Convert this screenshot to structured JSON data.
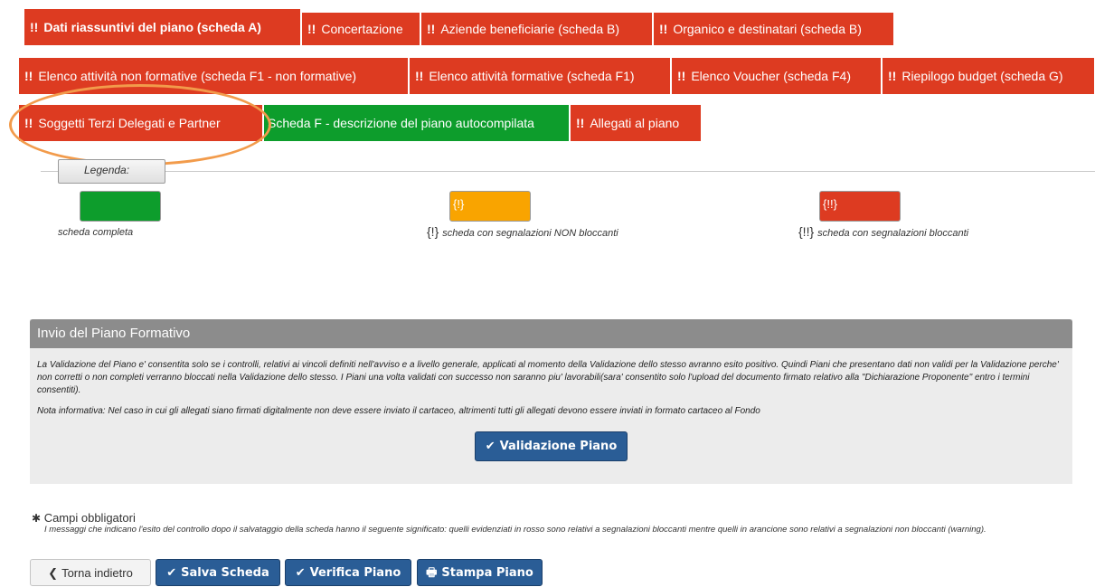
{
  "tabs": {
    "row1": [
      {
        "prefix": "!!",
        "label": "Dati riassuntivi del piano (scheda A)",
        "status": "red"
      },
      {
        "prefix": "!!",
        "label": "Concertazione",
        "status": "red"
      },
      {
        "prefix": "!!",
        "label": "Aziende beneficiarie (scheda B)",
        "status": "red"
      },
      {
        "prefix": "!!",
        "label": "Organico e destinatari (scheda B)",
        "status": "red"
      }
    ],
    "row2": [
      {
        "prefix": "!!",
        "label": "Elenco attività non formative (scheda F1 - non formative)",
        "status": "red"
      },
      {
        "prefix": "!!",
        "label": "Elenco attività formative (scheda F1)",
        "status": "red"
      },
      {
        "prefix": "!!",
        "label": "Elenco Voucher (scheda F4)",
        "status": "red"
      },
      {
        "prefix": "!!",
        "label": "Riepilogo budget (scheda G)",
        "status": "red"
      }
    ],
    "row3": [
      {
        "prefix": "!!",
        "label": "Soggetti Terzi Delegati e Partner",
        "status": "red"
      },
      {
        "prefix": "",
        "label": "Scheda F - descrizione del piano autocompilata",
        "status": "green"
      },
      {
        "prefix": "!!",
        "label": "Allegati al piano",
        "status": "red"
      }
    ]
  },
  "legend": {
    "title": "Legenda:",
    "items": [
      {
        "swatch_text": "",
        "mark": "",
        "text": "scheda completa",
        "color": "#0d9d2c"
      },
      {
        "swatch_text": "{!}",
        "mark": "{!}",
        "text": "scheda con segnalazioni NON bloccanti",
        "color": "#f9a400"
      },
      {
        "swatch_text": "{!!}",
        "mark": "{!!}",
        "text": "scheda con segnalazioni bloccanti",
        "color": "#dd3b21"
      }
    ]
  },
  "invio": {
    "title": "Invio del Piano Formativo",
    "paragraph1": "La Validazione del Piano e' consentita solo se i controlli, relativi ai vincoli definiti nell'avviso e a livello generale, applicati al momento della Validazione dello stesso avranno esito positivo. Quindi Piani che presentano dati non validi per la Validazione perche' non corretti o non completi verranno bloccati nella Validazione dello stesso. I Piani una volta validati con successo non saranno piu' lavorabili(sara' consentito solo l'upload del documento firmato relativo alla \"Dichiarazione Proponente\" entro i termini consentiti).",
    "paragraph2": "Nota informativa: Nel caso in cui gli allegati siano firmati digitalmente non deve essere inviato il cartaceo, altrimenti tutti gli allegati devono essere inviati in formato cartaceo al Fondo",
    "validate_label": "Validazione Piano"
  },
  "required": {
    "label": "Campi obbligatori",
    "note": "I messaggi che indicano l'esito del controllo dopo il salvataggio della scheda hanno il seguente significato: quelli evidenziati in rosso sono relativi a segnalazioni bloccanti mentre quelli in arancione sono relativi a segnalazioni non bloccanti (warning)."
  },
  "actions": {
    "back_label": "Torna indietro",
    "save_label": "Salva Scheda",
    "verify_label": "Verifica Piano",
    "print_label": "Stampa Piano"
  },
  "colors": {
    "red": "#dd3b21",
    "green": "#0d9d2c",
    "orange": "#f9a400",
    "blue": "#2a5d96",
    "highlight": "#f29b4b"
  }
}
